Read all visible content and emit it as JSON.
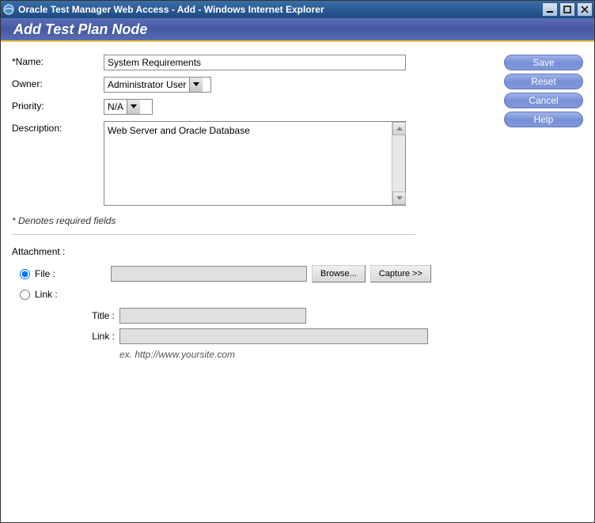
{
  "window": {
    "title": "Oracle Test Manager Web Access - Add - Windows Internet Explorer"
  },
  "header": {
    "title": "Add Test Plan Node"
  },
  "form": {
    "name_label": "*Name:",
    "name_value": "System Requirements",
    "owner_label": "Owner:",
    "owner_value": "Administrator User",
    "priority_label": "Priority:",
    "priority_value": "N/A",
    "description_label": "Description:",
    "description_value": "Web Server and Oracle Database",
    "required_note": "* Denotes required fields"
  },
  "attachment": {
    "section_label": "Attachment :",
    "file_label": "File :",
    "link_label": "Link :",
    "browse_label": "Browse...",
    "capture_label": "Capture >>",
    "title_label": "Title :",
    "linkfield_label": "Link :",
    "example_text": "ex. http://www.yoursite.com"
  },
  "buttons": {
    "save": "Save",
    "reset": "Reset",
    "cancel": "Cancel",
    "help": "Help"
  }
}
